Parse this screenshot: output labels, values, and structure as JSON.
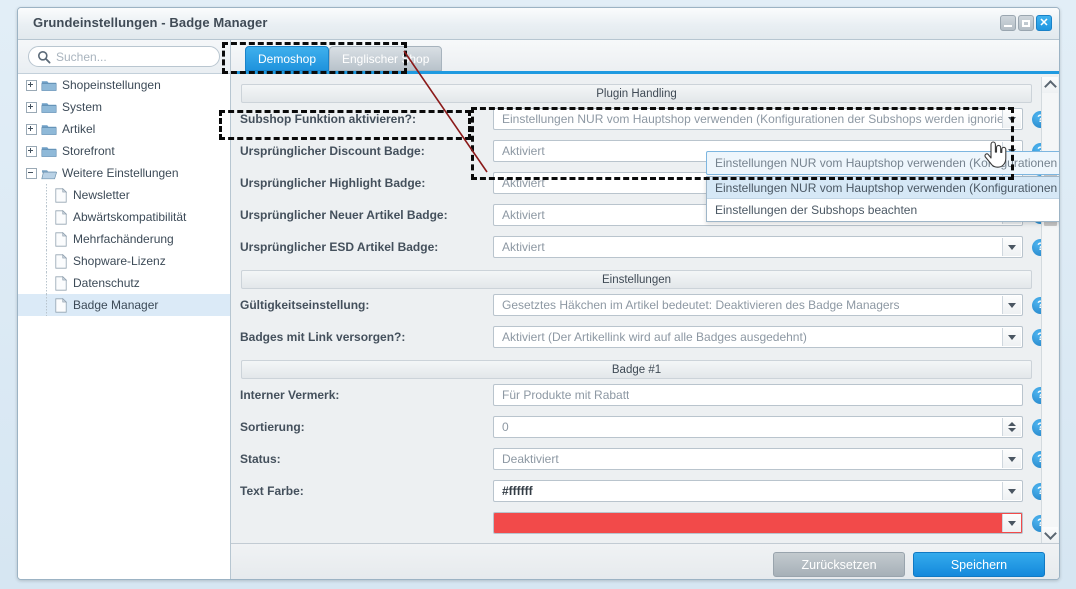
{
  "window": {
    "title": "Grundeinstellungen - Badge Manager",
    "controls": [
      {
        "name": "minimize",
        "glyph": "_"
      },
      {
        "name": "maximize",
        "glyph": "□"
      },
      {
        "name": "close",
        "glyph": "✕"
      }
    ]
  },
  "sidebar": {
    "search": {
      "placeholder": "Suchen...",
      "icon": "search-icon"
    },
    "tree": [
      {
        "label": "Shopeinstellungen",
        "type": "folder",
        "depth": 0,
        "state": "collapsed",
        "selected": false
      },
      {
        "label": "System",
        "type": "folder",
        "depth": 0,
        "state": "collapsed",
        "selected": false
      },
      {
        "label": "Artikel",
        "type": "folder",
        "depth": 0,
        "state": "collapsed",
        "selected": false
      },
      {
        "label": "Storefront",
        "type": "folder",
        "depth": 0,
        "state": "collapsed",
        "selected": false
      },
      {
        "label": "Weitere Einstellungen",
        "type": "folder",
        "depth": 0,
        "state": "expanded",
        "selected": false
      },
      {
        "label": "Newsletter",
        "type": "file",
        "depth": 1,
        "state": "leaf",
        "selected": false
      },
      {
        "label": "Abwärtskompatibilität",
        "type": "file",
        "depth": 1,
        "state": "leaf",
        "selected": false
      },
      {
        "label": "Mehrfachänderung",
        "type": "file",
        "depth": 1,
        "state": "leaf",
        "selected": false
      },
      {
        "label": "Shopware-Lizenz",
        "type": "file",
        "depth": 1,
        "state": "leaf",
        "selected": false
      },
      {
        "label": "Datenschutz",
        "type": "file",
        "depth": 1,
        "state": "leaf",
        "selected": false
      },
      {
        "label": "Badge Manager",
        "type": "file",
        "depth": 1,
        "state": "leaf",
        "selected": true
      }
    ]
  },
  "tabs": [
    {
      "label": "Demoshop",
      "active": true
    },
    {
      "label": "Englischer Shop",
      "active": false
    }
  ],
  "sections": [
    {
      "header": "Plugin Handling",
      "rows": [
        {
          "label": "Subshop Funktion aktivieren?:",
          "control": "combo-open",
          "value": "Einstellungen NUR vom Hauptshop verwenden (Konfigurationen der Subshops werden ignoriert!)",
          "help": "?",
          "options": [
            "Einstellungen NUR vom Hauptshop verwenden (Konfigurationen der Subshops werden ignoriert!)",
            "Einstellungen der Subshops beachten"
          ],
          "highlighted_option_index": 0
        },
        {
          "label": "Ursprünglicher Discount Badge:",
          "control": "combo",
          "value": "Aktiviert",
          "help": "?"
        },
        {
          "label": "Ursprünglicher Highlight Badge:",
          "control": "combo",
          "value": "Aktiviert",
          "help": "?"
        },
        {
          "label": "Ursprünglicher Neuer Artikel Badge:",
          "control": "combo",
          "value": "Aktiviert",
          "help": "?"
        },
        {
          "label": "Ursprünglicher ESD Artikel Badge:",
          "control": "combo",
          "value": "Aktiviert",
          "help": "?"
        }
      ]
    },
    {
      "header": "Einstellungen",
      "rows": [
        {
          "label": "Gültigkeitseinstellung:",
          "control": "combo",
          "value": "Gesetztes Häkchen im Artikel bedeutet: Deaktivieren des Badge Managers",
          "help": "?"
        },
        {
          "label": "Badges mit Link versorgen?:",
          "control": "combo",
          "value": "Aktiviert (Der Artikellink wird auf alle Badges ausgedehnt)",
          "help": "?"
        }
      ]
    },
    {
      "header": "Badge #1",
      "rows": [
        {
          "label": "Interner Vermerk:",
          "control": "text",
          "value": "Für Produkte mit Rabatt",
          "help": "?"
        },
        {
          "label": "Sortierung:",
          "control": "spinner",
          "value": "0",
          "help": "?"
        },
        {
          "label": "Status:",
          "control": "combo",
          "value": "Deaktiviert",
          "help": "?"
        },
        {
          "label": "Text Farbe:",
          "control": "combo",
          "value": "#ffffff",
          "value_style": "dark",
          "help": "?"
        },
        {
          "label": "",
          "control": "color-swatch",
          "value": "",
          "swatch_color": "#f24a4a",
          "help": "?"
        }
      ]
    }
  ],
  "footer": {
    "reset_label": "Zurücksetzen",
    "save_label": "Speichern"
  },
  "scrollbar": {
    "up_icon": "chevron-up-icon",
    "down_icon": "chevron-down-icon"
  },
  "colors": {
    "accent": "#1f9ae0",
    "tab_active": "#2f9ee4",
    "annotation": "#000000",
    "annotation_line": "#8b1a1a",
    "swatch_red": "#f24a4a",
    "help_blue": "#1f7fc4"
  }
}
